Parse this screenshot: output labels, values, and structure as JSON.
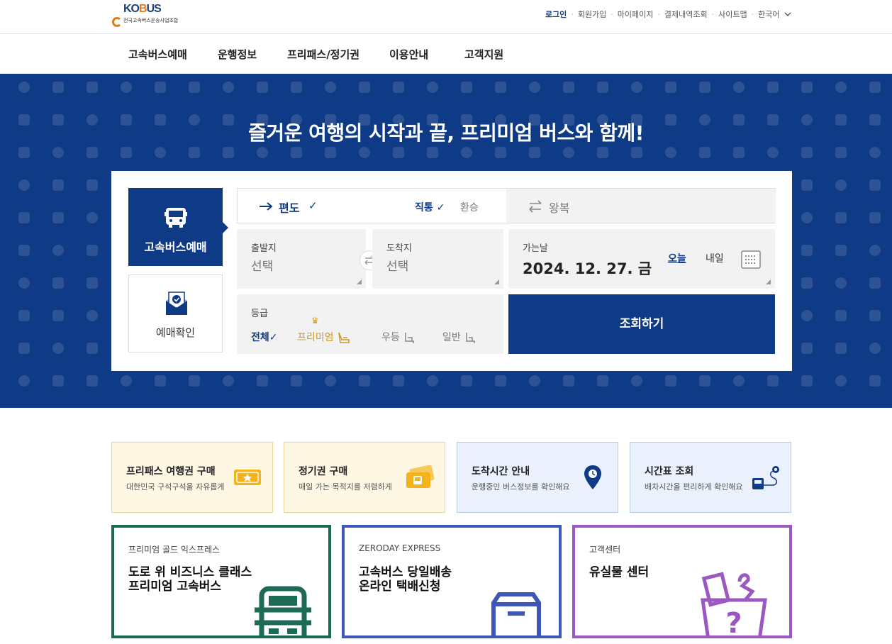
{
  "header": {
    "logo_text_a": "KO",
    "logo_text_b": "B",
    "logo_text_c": "US",
    "logo_sub": "전국고속버스운송사업조합",
    "util": [
      "로그인",
      "회원가입",
      "마이페이지",
      "결제내역조회",
      "사이트맵",
      "한국어"
    ]
  },
  "gnb": [
    "고속버스예매",
    "운행정보",
    "프리패스/정기권",
    "이용안내",
    "고객지원"
  ],
  "hero": {
    "title": "즐거운 여행의 시작과 끝, 프리미엄 버스와 함께!"
  },
  "booking": {
    "tab_book": "고속버스예매",
    "tab_check": "예매확인",
    "oneway": "편도",
    "direct": "직통",
    "transfer": "환승",
    "roundtrip": "왕복",
    "depart_label": "출발지",
    "depart_value": "선택",
    "arrive_label": "도착지",
    "arrive_value": "선택",
    "date_label": "가는날",
    "date_value": "2024. 12. 27. 금",
    "today": "오늘",
    "tomorrow": "내일",
    "grade_label": "등급",
    "grade_all": "전체",
    "grade_premium": "프리미엄",
    "grade_excellent": "우등",
    "grade_normal": "일반",
    "search": "조회하기"
  },
  "cards": [
    {
      "title": "프리패스 여행권 구매",
      "sub": "대한민국 구석구석을 자유롭게"
    },
    {
      "title": "정기권 구매",
      "sub": "매일 가는 목적지를 저렴하게"
    },
    {
      "title": "도착시간 안내",
      "sub": "운행중인 버스정보를 확인해요"
    },
    {
      "title": "시간표 조회",
      "sub": "배차시간을 편리하게 확인해요"
    }
  ],
  "promos": [
    {
      "kicker": "프리미엄 골드 익스프레스",
      "line1": "도로 위 비즈니스 클래스",
      "line2": "프리미엄 고속버스"
    },
    {
      "kicker": "ZERODAY EXPRESS",
      "line1": "고속버스 당일배송",
      "line2": "온라인 택배신청"
    },
    {
      "kicker": "고객센터",
      "line1": "유실물 센터",
      "line2": ""
    }
  ],
  "colors": {
    "brand_blue": "#0f3a86",
    "accent_orange": "#e07b1a",
    "gold": "#c89b2e",
    "promo_green": "#1d6b57",
    "promo_blue": "#3d56b8",
    "promo_purple": "#9b57c2"
  },
  "icons": [
    "bus-icon",
    "ticket-check-icon",
    "arrow-right-icon",
    "swap-icon",
    "calendar-icon",
    "crown-icon",
    "seat-icon",
    "location-pin-icon",
    "route-icon",
    "box-icon",
    "lost-item-icon"
  ]
}
